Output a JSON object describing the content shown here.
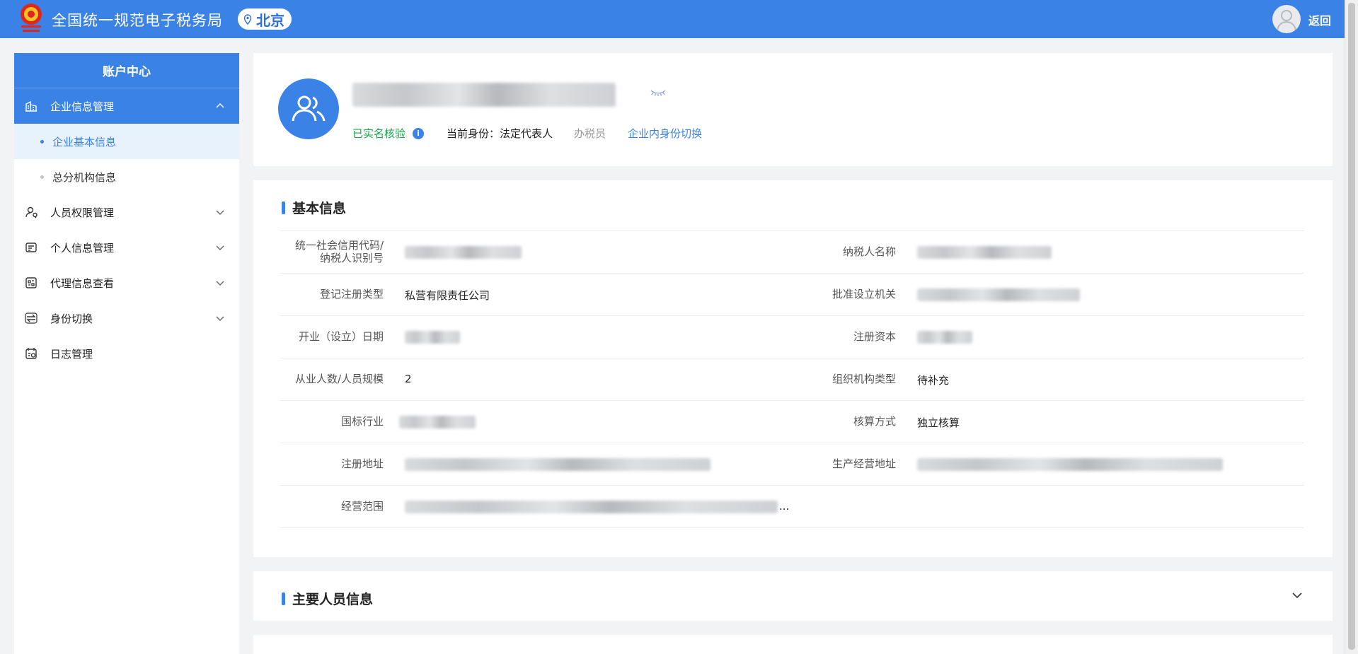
{
  "header": {
    "title": "全国统一规范电子税务局",
    "location": "北京",
    "back_label": "返回"
  },
  "sidebar": {
    "title": "账户中心",
    "items": [
      {
        "label": "企业信息管理",
        "icon": "building-icon",
        "expanded": true
      },
      {
        "label": "人员权限管理",
        "icon": "user-search-icon"
      },
      {
        "label": "个人信息管理",
        "icon": "id-card-icon"
      },
      {
        "label": "代理信息查看",
        "icon": "agent-icon"
      },
      {
        "label": "身份切换",
        "icon": "switch-icon"
      },
      {
        "label": "日志管理",
        "icon": "log-icon"
      }
    ],
    "sub_items": [
      {
        "label": "企业基本信息",
        "active": true
      },
      {
        "label": "总分机构信息"
      }
    ]
  },
  "profile": {
    "verified": "已实名核验",
    "identity": "当前身份：法定代表人",
    "other_role": "办税员",
    "switch_link": "企业内身份切换"
  },
  "basic_info": {
    "title": "基本信息",
    "labels": {
      "credit_code": "统一社会信用代码/纳税人识别号",
      "credit_code_1": "统一社会信用代码/",
      "credit_code_2": "纳税人识别号",
      "taxpayer_name": "纳税人名称",
      "reg_type": "登记注册类型",
      "approval_org": "批准设立机关",
      "open_date": "开业（设立）日期",
      "reg_capital": "注册资本",
      "employees": "从业人数/人员规模",
      "org_type": "组织机构类型",
      "industry": "国标行业",
      "accounting": "核算方式",
      "reg_address": "注册地址",
      "biz_address": "生产经营地址",
      "biz_scope": "经营范围"
    },
    "values": {
      "reg_type": "私营有限责任公司",
      "employees": "2",
      "org_type": "待补充",
      "accounting": "独立核算",
      "scope_ellipsis": "..."
    }
  },
  "staff_section": {
    "title": "主要人员信息"
  },
  "colors": {
    "primary": "#3b82e6",
    "verified_green": "#19a64d",
    "page_bg": "#f2f3f5"
  }
}
